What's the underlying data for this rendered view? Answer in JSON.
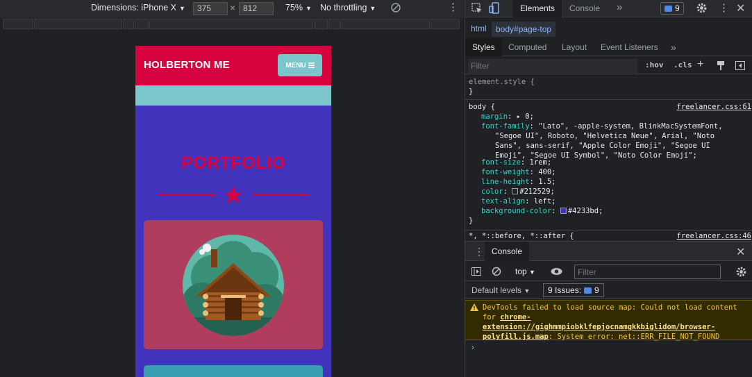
{
  "device_toolbar": {
    "dimensions_label": "Dimensions: iPhone X",
    "width": "375",
    "height": "812",
    "times": "×",
    "zoom": "75%",
    "throttling": "No throttling"
  },
  "page": {
    "brand": "HOLBERTON ME",
    "menu_label": "MENU",
    "heading": "PORTFOLIO",
    "colors": {
      "nav": "#d6033f",
      "teal": "#7ac6cb",
      "background": "#4233bd",
      "card1": "#b03c5e",
      "card2": "#3a9fb0"
    }
  },
  "devtools": {
    "tabs": [
      "Elements",
      "Console"
    ],
    "issues_count": "9",
    "breadcrumb": {
      "html": "html",
      "body": "body#page-top"
    },
    "styles_tabs": [
      "Styles",
      "Computed",
      "Layout",
      "Event Listeners"
    ],
    "filter_placeholder": "Filter",
    "hov": ":hov",
    "cls": ".cls",
    "element_style": {
      "selector": "element.style {",
      "close": "}"
    },
    "body_rule": {
      "selector": "body {",
      "source": "freelancer.css:61",
      "margin_prop": "margin",
      "margin_val": ": ▸ 0;",
      "font_family_prop": "font-family",
      "font_family_val": ": \"Lato\", -apple-system, BlinkMacSystemFont, \"Segoe UI\", Roboto, \"Helvetica Neue\", Arial, \"Noto Sans\", sans-serif, \"Apple Color Emoji\", \"Segoe UI Emoji\", \"Segoe UI Symbol\", \"Noto Color Emoji\";",
      "font_size_prop": "font-size",
      "font_size_val": ": 1rem;",
      "font_weight_prop": "font-weight",
      "font_weight_val": ": 400;",
      "line_height_prop": "line-height",
      "line_height_val": ": 1.5;",
      "color_prop": "color",
      "color_val": "#212529;",
      "text_align_prop": "text-align",
      "text_align_val": ": left;",
      "bg_prop": "background-color",
      "bg_val": "#4233bd;",
      "close": "}"
    },
    "star_rule": {
      "selector": "*, *::before, *::after {",
      "source": "freelancer.css:46"
    },
    "console": {
      "tab": "Console",
      "context": "top",
      "filter_placeholder": "Filter",
      "levels": "Default levels",
      "issues": "9 Issues:",
      "issues_count": "9",
      "warning_prefix": "DevTools failed to load source map: Could not load content for ",
      "warning_link": "chrome-extension://gighmmpiobklfepjocnamgkkbiglidom/browser-polyfill.js.map",
      "warning_suffix": ": System error: net::ERR_FILE_NOT_FOUND",
      "prompt": "›"
    }
  }
}
